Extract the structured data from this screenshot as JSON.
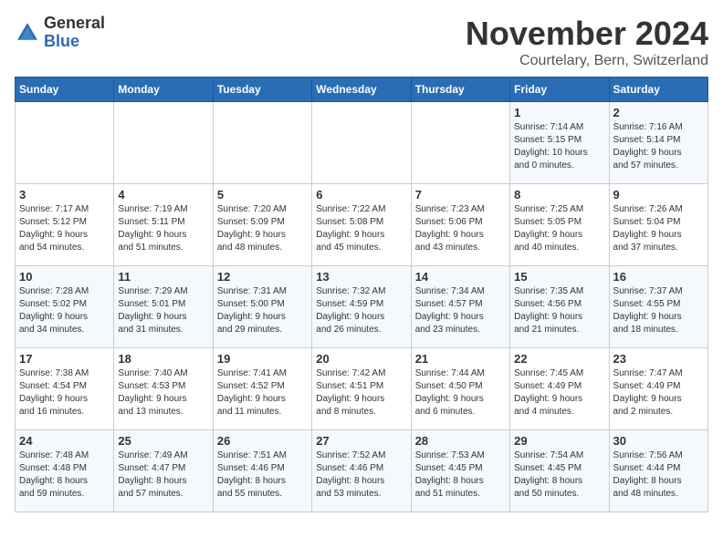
{
  "logo": {
    "general": "General",
    "blue": "Blue"
  },
  "title": "November 2024",
  "location": "Courtelary, Bern, Switzerland",
  "weekdays": [
    "Sunday",
    "Monday",
    "Tuesday",
    "Wednesday",
    "Thursday",
    "Friday",
    "Saturday"
  ],
  "weeks": [
    [
      {
        "day": "",
        "info": ""
      },
      {
        "day": "",
        "info": ""
      },
      {
        "day": "",
        "info": ""
      },
      {
        "day": "",
        "info": ""
      },
      {
        "day": "",
        "info": ""
      },
      {
        "day": "1",
        "info": "Sunrise: 7:14 AM\nSunset: 5:15 PM\nDaylight: 10 hours\nand 0 minutes."
      },
      {
        "day": "2",
        "info": "Sunrise: 7:16 AM\nSunset: 5:14 PM\nDaylight: 9 hours\nand 57 minutes."
      }
    ],
    [
      {
        "day": "3",
        "info": "Sunrise: 7:17 AM\nSunset: 5:12 PM\nDaylight: 9 hours\nand 54 minutes."
      },
      {
        "day": "4",
        "info": "Sunrise: 7:19 AM\nSunset: 5:11 PM\nDaylight: 9 hours\nand 51 minutes."
      },
      {
        "day": "5",
        "info": "Sunrise: 7:20 AM\nSunset: 5:09 PM\nDaylight: 9 hours\nand 48 minutes."
      },
      {
        "day": "6",
        "info": "Sunrise: 7:22 AM\nSunset: 5:08 PM\nDaylight: 9 hours\nand 45 minutes."
      },
      {
        "day": "7",
        "info": "Sunrise: 7:23 AM\nSunset: 5:06 PM\nDaylight: 9 hours\nand 43 minutes."
      },
      {
        "day": "8",
        "info": "Sunrise: 7:25 AM\nSunset: 5:05 PM\nDaylight: 9 hours\nand 40 minutes."
      },
      {
        "day": "9",
        "info": "Sunrise: 7:26 AM\nSunset: 5:04 PM\nDaylight: 9 hours\nand 37 minutes."
      }
    ],
    [
      {
        "day": "10",
        "info": "Sunrise: 7:28 AM\nSunset: 5:02 PM\nDaylight: 9 hours\nand 34 minutes."
      },
      {
        "day": "11",
        "info": "Sunrise: 7:29 AM\nSunset: 5:01 PM\nDaylight: 9 hours\nand 31 minutes."
      },
      {
        "day": "12",
        "info": "Sunrise: 7:31 AM\nSunset: 5:00 PM\nDaylight: 9 hours\nand 29 minutes."
      },
      {
        "day": "13",
        "info": "Sunrise: 7:32 AM\nSunset: 4:59 PM\nDaylight: 9 hours\nand 26 minutes."
      },
      {
        "day": "14",
        "info": "Sunrise: 7:34 AM\nSunset: 4:57 PM\nDaylight: 9 hours\nand 23 minutes."
      },
      {
        "day": "15",
        "info": "Sunrise: 7:35 AM\nSunset: 4:56 PM\nDaylight: 9 hours\nand 21 minutes."
      },
      {
        "day": "16",
        "info": "Sunrise: 7:37 AM\nSunset: 4:55 PM\nDaylight: 9 hours\nand 18 minutes."
      }
    ],
    [
      {
        "day": "17",
        "info": "Sunrise: 7:38 AM\nSunset: 4:54 PM\nDaylight: 9 hours\nand 16 minutes."
      },
      {
        "day": "18",
        "info": "Sunrise: 7:40 AM\nSunset: 4:53 PM\nDaylight: 9 hours\nand 13 minutes."
      },
      {
        "day": "19",
        "info": "Sunrise: 7:41 AM\nSunset: 4:52 PM\nDaylight: 9 hours\nand 11 minutes."
      },
      {
        "day": "20",
        "info": "Sunrise: 7:42 AM\nSunset: 4:51 PM\nDaylight: 9 hours\nand 8 minutes."
      },
      {
        "day": "21",
        "info": "Sunrise: 7:44 AM\nSunset: 4:50 PM\nDaylight: 9 hours\nand 6 minutes."
      },
      {
        "day": "22",
        "info": "Sunrise: 7:45 AM\nSunset: 4:49 PM\nDaylight: 9 hours\nand 4 minutes."
      },
      {
        "day": "23",
        "info": "Sunrise: 7:47 AM\nSunset: 4:49 PM\nDaylight: 9 hours\nand 2 minutes."
      }
    ],
    [
      {
        "day": "24",
        "info": "Sunrise: 7:48 AM\nSunset: 4:48 PM\nDaylight: 8 hours\nand 59 minutes."
      },
      {
        "day": "25",
        "info": "Sunrise: 7:49 AM\nSunset: 4:47 PM\nDaylight: 8 hours\nand 57 minutes."
      },
      {
        "day": "26",
        "info": "Sunrise: 7:51 AM\nSunset: 4:46 PM\nDaylight: 8 hours\nand 55 minutes."
      },
      {
        "day": "27",
        "info": "Sunrise: 7:52 AM\nSunset: 4:46 PM\nDaylight: 8 hours\nand 53 minutes."
      },
      {
        "day": "28",
        "info": "Sunrise: 7:53 AM\nSunset: 4:45 PM\nDaylight: 8 hours\nand 51 minutes."
      },
      {
        "day": "29",
        "info": "Sunrise: 7:54 AM\nSunset: 4:45 PM\nDaylight: 8 hours\nand 50 minutes."
      },
      {
        "day": "30",
        "info": "Sunrise: 7:56 AM\nSunset: 4:44 PM\nDaylight: 8 hours\nand 48 minutes."
      }
    ]
  ]
}
